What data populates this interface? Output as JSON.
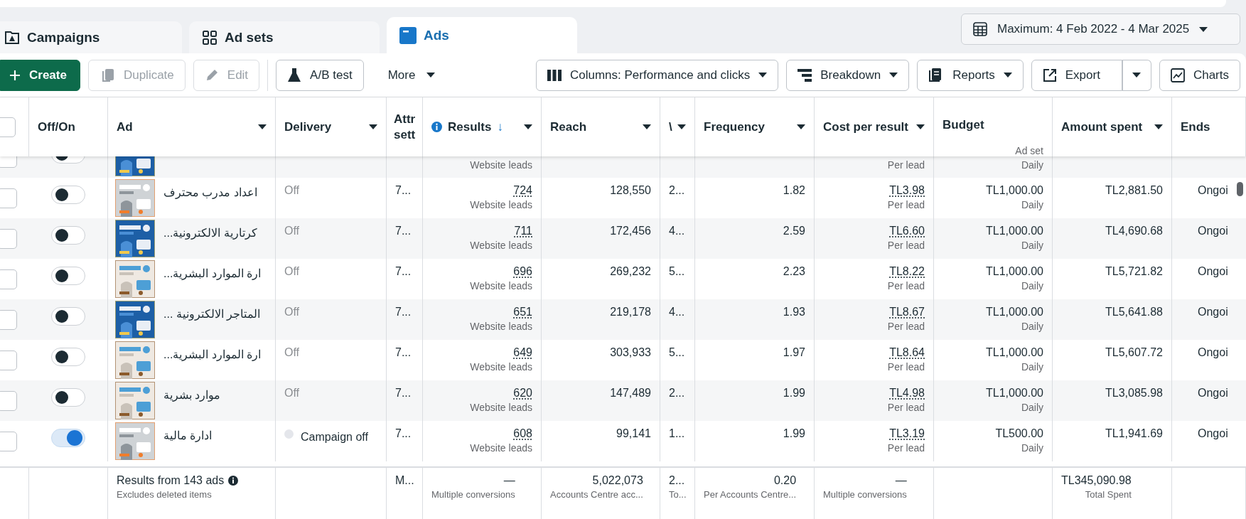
{
  "tabs": [
    {
      "label": "Campaigns",
      "selected": false
    },
    {
      "label": "Ad sets",
      "selected": false
    },
    {
      "label": "Ads",
      "selected": true
    }
  ],
  "date_range": {
    "label": "Maximum: 4 Feb 2022 - 4 Mar 2025"
  },
  "toolbar": [
    {
      "label": "Create",
      "kind": "primary",
      "disabled": false
    },
    {
      "label": "Duplicate",
      "kind": "outline",
      "disabled": true
    },
    {
      "label": "Edit",
      "kind": "outline",
      "disabled": true
    },
    {
      "label": "A/B test",
      "kind": "outline",
      "disabled": false
    },
    {
      "label": "More",
      "kind": "menu",
      "disabled": false
    },
    {
      "label": "Columns: Performance and clicks",
      "kind": "dropdown",
      "disabled": false
    },
    {
      "label": "Breakdown",
      "kind": "dropdown",
      "disabled": false
    },
    {
      "label": "Reports",
      "kind": "dropdown",
      "disabled": false
    },
    {
      "label": "Export",
      "kind": "split",
      "disabled": false
    },
    {
      "label": "Charts",
      "kind": "outline",
      "disabled": false
    }
  ],
  "table": {
    "columns": [
      {
        "kind": "checkbox",
        "checked": false
      },
      {
        "label": "Off/On",
        "caret": false
      },
      {
        "label": "Ad",
        "caret": true
      },
      {
        "label": "Delivery",
        "caret": true
      },
      {
        "label": "Attr sett",
        "caret": false
      },
      {
        "label": "Results",
        "caret": true,
        "info": true,
        "sort_arrow": "↓"
      },
      {
        "label": "Reach",
        "caret": true
      },
      {
        "label": "\\",
        "caret": true
      },
      {
        "label": "Frequency",
        "caret": true
      },
      {
        "label": "Cost per result",
        "caret": true
      },
      {
        "label": "Budget",
        "caret": false,
        "sublabel": "Ad set"
      },
      {
        "label": "Amount spent",
        "caret": true
      },
      {
        "label": "Ends",
        "caret": false
      }
    ],
    "rows": [
      {
        "kind": "partial",
        "selected": false,
        "on": false,
        "results": {
          "label": "Website leads"
        },
        "cost_per_result": {
          "label": "Per lead"
        },
        "budget": {
          "label": "Daily"
        }
      },
      {
        "kind": "full",
        "selected": false,
        "on": false,
        "name": "اعداد مدرب محترف",
        "delivery": {
          "kind": "off",
          "text": "Off"
        },
        "attribution": "7...",
        "results": {
          "value": "724",
          "label": "Website leads"
        },
        "reach": "128,550",
        "column_8": "2...",
        "frequency": "1.82",
        "cost_per_result": {
          "value": "TL3.98",
          "label": "Per lead"
        },
        "budget": {
          "value": "TL1,000.00",
          "label": "Daily"
        },
        "amount_spent": "TL2,881.50",
        "ends": "Ongoi"
      },
      {
        "kind": "full",
        "selected": false,
        "on": false,
        "name": "...كرتارية الالكترونية",
        "delivery": {
          "kind": "off",
          "text": "Off"
        },
        "attribution": "7...",
        "results": {
          "value": "711",
          "label": "Website leads"
        },
        "reach": "172,456",
        "column_8": "4...",
        "frequency": "2.59",
        "cost_per_result": {
          "value": "TL6.60",
          "label": "Per lead"
        },
        "budget": {
          "value": "TL1,000.00",
          "label": "Daily"
        },
        "amount_spent": "TL4,690.68",
        "ends": "Ongoi"
      },
      {
        "kind": "full",
        "selected": false,
        "on": false,
        "name": "...ارة الموارد البشرية",
        "delivery": {
          "kind": "off",
          "text": "Off"
        },
        "attribution": "7...",
        "results": {
          "value": "696",
          "label": "Website leads"
        },
        "reach": "269,232",
        "column_8": "5...",
        "frequency": "2.23",
        "cost_per_result": {
          "value": "TL8.22",
          "label": "Per lead"
        },
        "budget": {
          "value": "TL1,000.00",
          "label": "Daily"
        },
        "amount_spent": "TL5,721.82",
        "ends": "Ongoi"
      },
      {
        "kind": "full",
        "selected": false,
        "on": false,
        "name": "... المتاجر الالكترونية",
        "delivery": {
          "kind": "off",
          "text": "Off"
        },
        "attribution": "7...",
        "results": {
          "value": "651",
          "label": "Website leads"
        },
        "reach": "219,178",
        "column_8": "4...",
        "frequency": "1.93",
        "cost_per_result": {
          "value": "TL8.67",
          "label": "Per lead"
        },
        "budget": {
          "value": "TL1,000.00",
          "label": "Daily"
        },
        "amount_spent": "TL5,641.88",
        "ends": "Ongoi"
      },
      {
        "kind": "full",
        "selected": false,
        "on": false,
        "name": "...ارة الموارد البشرية",
        "delivery": {
          "kind": "off",
          "text": "Off"
        },
        "attribution": "7...",
        "results": {
          "value": "649",
          "label": "Website leads"
        },
        "reach": "303,933",
        "column_8": "5...",
        "frequency": "1.97",
        "cost_per_result": {
          "value": "TL8.64",
          "label": "Per lead"
        },
        "budget": {
          "value": "TL1,000.00",
          "label": "Daily"
        },
        "amount_spent": "TL5,607.72",
        "ends": "Ongoi"
      },
      {
        "kind": "full",
        "selected": false,
        "on": false,
        "name": "موارد بشرية",
        "delivery": {
          "kind": "off",
          "text": "Off"
        },
        "attribution": "7...",
        "results": {
          "value": "620",
          "label": "Website leads"
        },
        "reach": "147,489",
        "column_8": "2...",
        "frequency": "1.99",
        "cost_per_result": {
          "value": "TL4.98",
          "label": "Per lead"
        },
        "budget": {
          "value": "TL1,000.00",
          "label": "Daily"
        },
        "amount_spent": "TL3,085.98",
        "ends": "Ongoi"
      },
      {
        "kind": "full",
        "selected": false,
        "on": true,
        "name": "ادارة مالية",
        "delivery": {
          "kind": "campaign_off",
          "text": "Campaign off"
        },
        "attribution": "7...",
        "results": {
          "value": "608",
          "label": "Website leads"
        },
        "reach": "99,141",
        "column_8": "1...",
        "frequency": "1.99",
        "cost_per_result": {
          "value": "TL3.19",
          "label": "Per lead"
        },
        "budget": {
          "value": "TL500.00",
          "label": "Daily"
        },
        "amount_spent": "TL1,941.69",
        "ends": "Ongoi"
      }
    ],
    "footer": {
      "summary": "Results from 143 ads",
      "note": "Excludes deleted items",
      "attribution": {
        "value": "M..."
      },
      "results": {
        "value": "—",
        "label": "Multiple conversions"
      },
      "reach": {
        "value": "5,022,073",
        "label": "Accounts Centre acc..."
      },
      "column_8": {
        "value": "2...",
        "label": "To..."
      },
      "frequency": {
        "value": "0.20",
        "label": "Per Accounts Centre..."
      },
      "cost_per_result": {
        "value": "—",
        "label": "Multiple conversions"
      },
      "amount_spent": {
        "value": "TL345,090.98",
        "label": "Total Spent"
      }
    }
  }
}
